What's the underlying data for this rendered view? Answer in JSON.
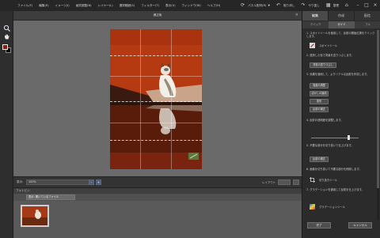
{
  "menubar": {
    "items": [
      "ファイル(F)",
      "編集(E)",
      "イメージ(I)",
      "画質調整(N)",
      "レイヤー(L)",
      "選択範囲(S)",
      "フィルター(T)",
      "表示(V)",
      "ウィンドウ(W)",
      "ヘルプ(H)"
    ],
    "actions": {
      "create_label": "パネル配列(R)",
      "undo_label": "取り消し",
      "redo_label": "やり直し",
      "organizer_label": "整理"
    }
  },
  "document": {
    "title": "補正後"
  },
  "statusbar": {
    "zoom_label": "表示:",
    "zoom_value": "100%",
    "layout_label": "レイアウト"
  },
  "photo_bin": {
    "title": "フォトビン",
    "select_value": "表示: 開いているファイル"
  },
  "panel": {
    "mode_tabs": [
      "編集",
      "作成",
      "配信"
    ],
    "active_mode": "編集",
    "sub_tabs": [
      "クイック",
      "ガイド",
      "フル"
    ],
    "active_sub": "ガイド",
    "steps": [
      "1. スポイトツールを使用して、反射の開始位置をクリックします。",
      "2. 選択した色で背景を塗りつぶします。",
      "3. 効果を適用して、よりリアルな反射を作成します。",
      "4. 反射の透明度を調整します。",
      "5. 不要な部分を切り抜いて仕上げます。",
      "6. 画像を切り抜いて不要な部分を削除します。",
      "7. グラデーションを適用して反射を仕上げます。"
    ],
    "eyedropper_label": "スポイトツール",
    "buttons": {
      "fill_bg": "背景の塗りつぶし",
      "apply_effect1": "強度の調整",
      "apply_effect2": "ぼかしの適用",
      "apply_effect3": "変形",
      "apply_effect4": "反射の補正",
      "crop_label": "切り抜きツール",
      "gradient_label": "グラデーションツール",
      "done": "完了",
      "cancel": "キャンセル"
    }
  },
  "colors": {
    "foreground": "#8a1e0a",
    "background": "#000000",
    "photo_main": "#b53a12"
  }
}
